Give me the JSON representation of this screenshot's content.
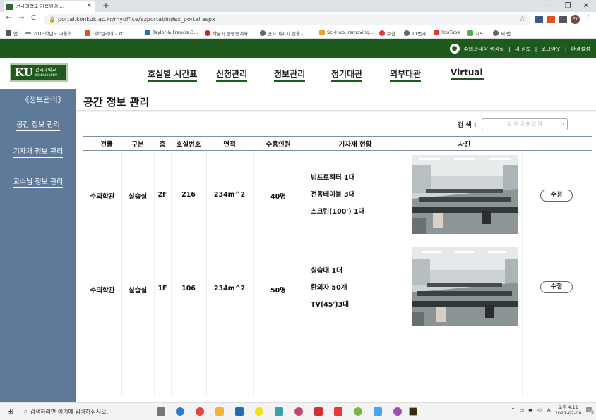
{
  "browser": {
    "tab_title": "건국대학교 기룸웨어 ...",
    "url": "portal.konkuk.ac.kr/myoffice/ezportal/index_portal.aspx",
    "new_tab": "+",
    "profile": "EY",
    "bookmarks": [
      "앱",
      "2013학년도 가을학...",
      "대학알리미 - KO...",
      "Taylor & Francis O...",
      "학술지 증명증계사",
      "공자 메시지 진용 -...",
      "Sci-Hub: removing...",
      "주한",
      "11번가",
      "YouTube",
      "지도",
      "새 탭"
    ]
  },
  "topbar": {
    "user": "수의과대학 행정실",
    "links": [
      "내 정보",
      "로그아웃",
      "환경설정"
    ]
  },
  "header": {
    "logo_ku": "KU",
    "logo_name": "건국대학교",
    "logo_sub": "KONKUK UNIV.",
    "menu": [
      "호실별 시간표",
      "신청관리",
      "정보관리",
      "정기대관",
      "외부대관",
      "Virtual"
    ]
  },
  "sidebar": {
    "title": "《정보관리》",
    "items": [
      "공간 정보 관리",
      "기자재 정보 관리",
      "교수님 정보 관리"
    ]
  },
  "main": {
    "title": "공간 정보 관리",
    "search_label": "검 색 :",
    "search_placeholder": "검 색 내 용 입 력",
    "columns": [
      "건물",
      "구분",
      "층",
      "호실번호",
      "면적",
      "수용인원",
      "기자재 현황",
      "사진"
    ],
    "rows": [
      {
        "building": "수의학관",
        "type": "실습실",
        "floor": "2F",
        "room": "216",
        "area": "234m^2",
        "capacity": "40명",
        "equipment": [
          "빔프로젝터 1대",
          "전동테이블 3대",
          "스크린(100') 1대"
        ],
        "edit": "수정"
      },
      {
        "building": "수의학관",
        "type": "실습실",
        "floor": "1F",
        "room": "106",
        "area": "234m^2",
        "capacity": "50명",
        "equipment": [
          "실습대 1대",
          "환의자 50개",
          "TV(45')3대"
        ],
        "edit": "수정"
      }
    ]
  },
  "taskbar": {
    "search": "검색하려면 여기에 입력하십시오.",
    "time": "오후 4:11",
    "date": "2021-02-08",
    "notif": "8"
  }
}
